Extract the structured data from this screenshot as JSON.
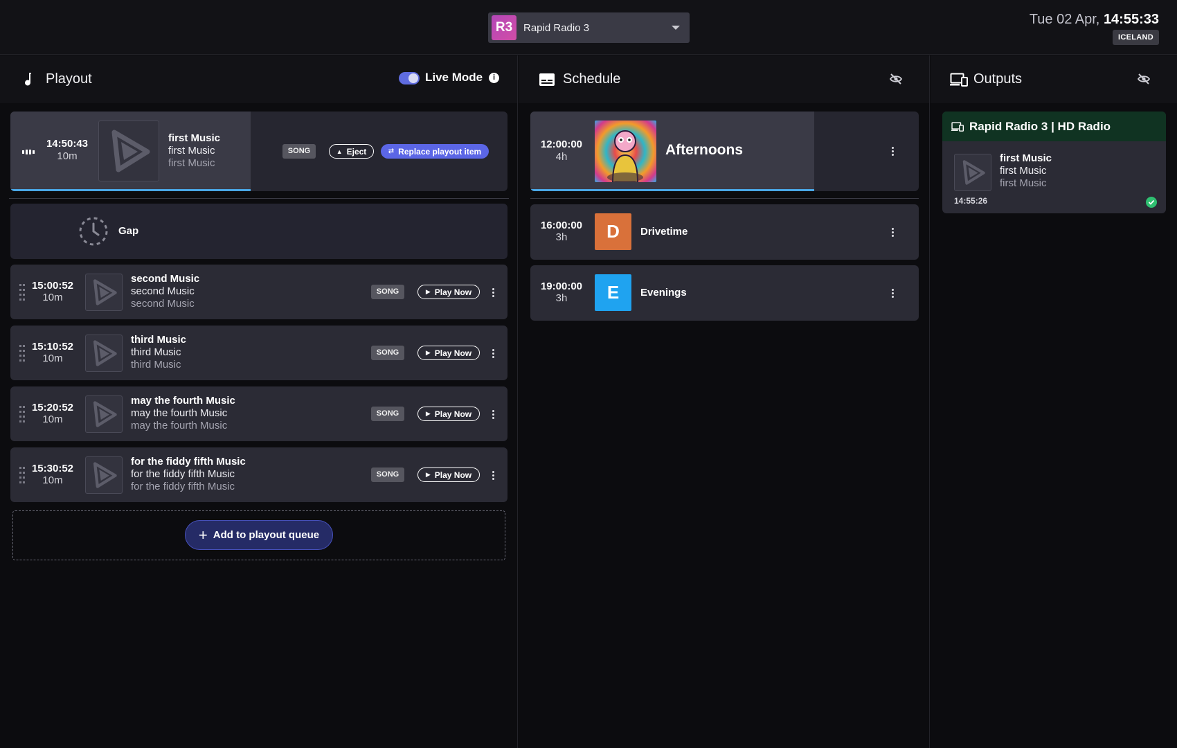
{
  "header": {
    "station": {
      "logo_text": "R3",
      "name": "Rapid Radio 3"
    },
    "clock": {
      "date": "Tue 02 Apr,",
      "time": "14:55:33",
      "timezone": "ICELAND"
    }
  },
  "playout": {
    "title": "Playout",
    "live_mode_label": "Live Mode",
    "live_mode_on": true,
    "current": {
      "time": "14:50:43",
      "duration": "10m",
      "line1": "first Music",
      "line2": "first Music",
      "line3": "first Music",
      "badge": "SONG",
      "eject_label": "Eject",
      "replace_label": "Replace playout item"
    },
    "gap_label": "Gap",
    "queue": [
      {
        "time": "15:00:52",
        "duration": "10m",
        "line1": "second Music",
        "line2": "second Music",
        "line3": "second Music",
        "badge": "SONG",
        "action": "Play Now"
      },
      {
        "time": "15:10:52",
        "duration": "10m",
        "line1": "third Music",
        "line2": "third Music",
        "line3": "third Music",
        "badge": "SONG",
        "action": "Play Now"
      },
      {
        "time": "15:20:52",
        "duration": "10m",
        "line1": "may the fourth Music",
        "line2": "may the fourth Music",
        "line3": "may the fourth Music",
        "badge": "SONG",
        "action": "Play Now"
      },
      {
        "time": "15:30:52",
        "duration": "10m",
        "line1": "for the fiddy fifth Music",
        "line2": "for the fiddy fifth Music",
        "line3": "for the fiddy fifth Music",
        "badge": "SONG",
        "action": "Play Now"
      }
    ],
    "add_label": "Add to playout queue"
  },
  "schedule": {
    "title": "Schedule",
    "items": [
      {
        "time": "12:00:00",
        "duration": "4h",
        "title": "Afternoons"
      },
      {
        "time": "16:00:00",
        "duration": "3h",
        "title": "Drivetime",
        "letter": "D",
        "color": "#d9713a"
      },
      {
        "time": "19:00:00",
        "duration": "3h",
        "title": "Evenings",
        "letter": "E",
        "color": "#1fa3f0"
      }
    ]
  },
  "outputs": {
    "title": "Outputs",
    "card": {
      "name": "Rapid Radio 3 | HD Radio",
      "line1": "first Music",
      "line2": "first Music",
      "line3": "first Music",
      "time": "14:55:26",
      "status": "ok"
    }
  },
  "colors": {
    "accent": "#5b66e6",
    "progress": "#4aa7e6",
    "ok": "#2fbf71",
    "output_header": "#103322"
  }
}
